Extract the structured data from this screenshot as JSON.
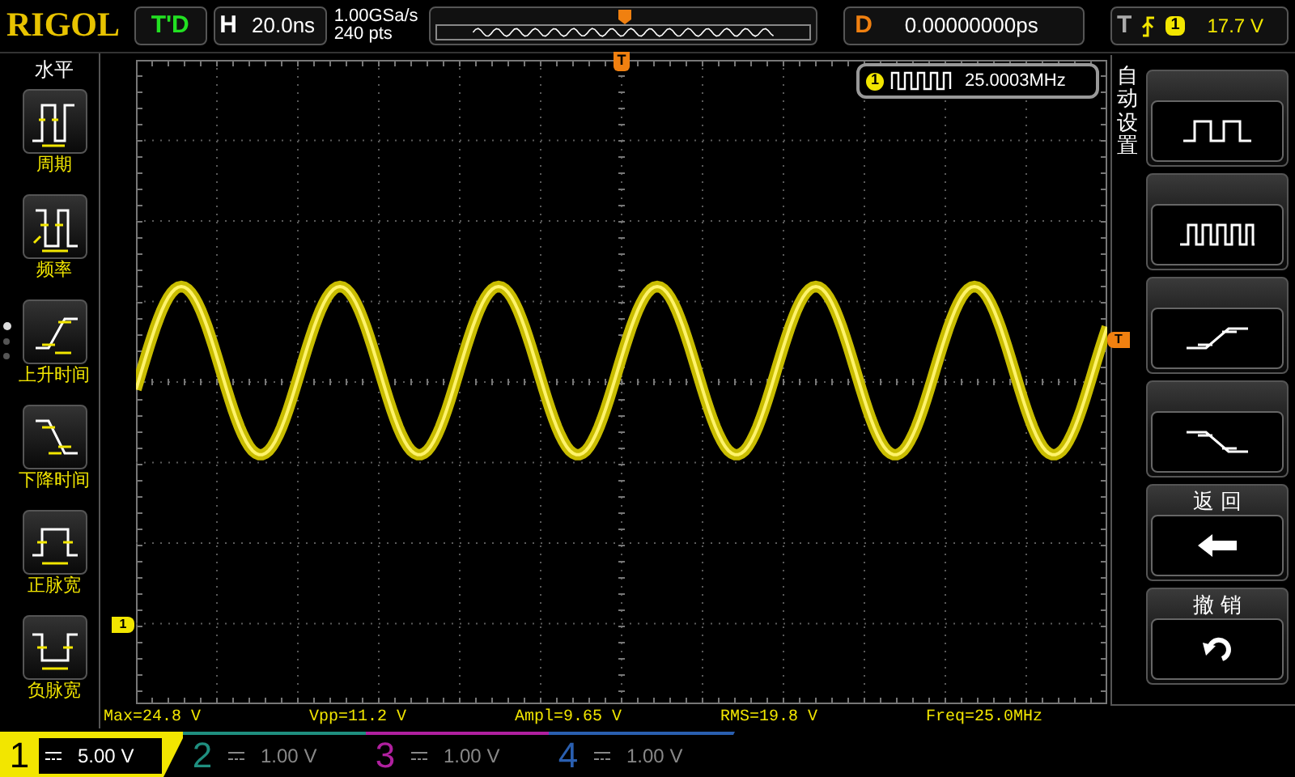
{
  "top_bar": {
    "logo": "RIGOL",
    "run_status": "T'D",
    "horizontal": {
      "label": "H",
      "value": "20.0ns"
    },
    "sample_rate": "1.00GSa/s",
    "memory_depth": "240 pts",
    "delay": {
      "label": "D",
      "value": "0.00000000ps"
    },
    "trigger": {
      "label": "T",
      "source": "1",
      "level": "17.7 V"
    }
  },
  "left_menu": {
    "title": "水平",
    "pages": [
      {
        "selected": true
      },
      {
        "selected": false
      },
      {
        "selected": false
      }
    ],
    "items": [
      {
        "label": "周期",
        "kind": "period"
      },
      {
        "label": "频率",
        "kind": "frequency"
      },
      {
        "label": "上升时间",
        "kind": "rise"
      },
      {
        "label": "下降时间",
        "kind": "fall"
      },
      {
        "label": "正脉宽",
        "kind": "positive_width"
      },
      {
        "label": "负脉宽",
        "kind": "negative_width"
      }
    ]
  },
  "display": {
    "trigger_position_marker": "T",
    "trigger_level_marker": "T",
    "channel_marker": "1",
    "frequency_readout": {
      "channel": "1",
      "value": "25.0003MHz"
    }
  },
  "right_menu": {
    "title": "自动设置",
    "buttons": [
      {
        "kind": "square"
      },
      {
        "kind": "pulse"
      },
      {
        "kind": "rise"
      },
      {
        "kind": "fall"
      },
      {
        "kind": "back",
        "label": "返 回"
      },
      {
        "kind": "undo",
        "label": "撤 销"
      }
    ]
  },
  "measurements": [
    "Max=24.8 V",
    "Vpp=11.2 V",
    "Ampl=9.65 V",
    "RMS=19.8 V",
    "Freq=25.0MHz"
  ],
  "channels": [
    {
      "number": "1",
      "scale": "5.00 V",
      "on": true,
      "color": "#f2e600"
    },
    {
      "number": "2",
      "scale": "1.00 V",
      "on": false,
      "color": "#1f8f80"
    },
    {
      "number": "3",
      "scale": "1.00 V",
      "on": false,
      "color": "#b0209f"
    },
    {
      "number": "4",
      "scale": "1.00 V",
      "on": false,
      "color": "#2a5fb0"
    }
  ]
}
